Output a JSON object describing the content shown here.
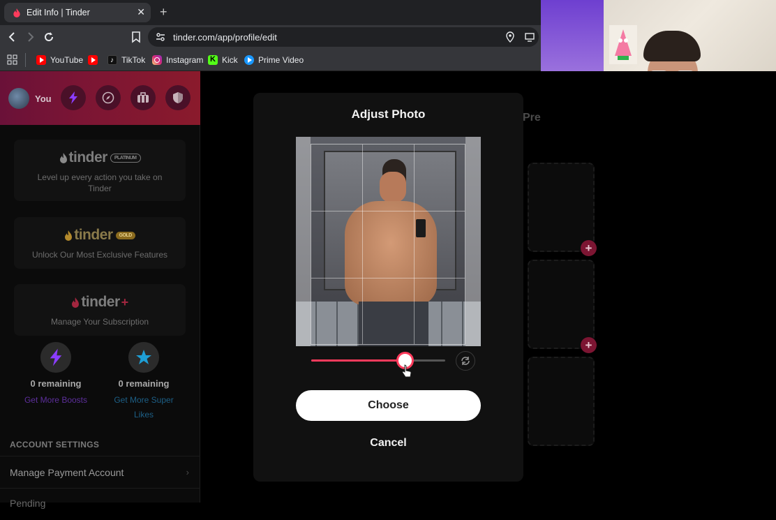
{
  "browser": {
    "tab_title": "Edit Info | Tinder",
    "tab_close": "✕",
    "new_tab": "+",
    "url": "tinder.com/app/profile/edit",
    "bookmarks": [
      {
        "label": "YouTube",
        "color": "#ff0000"
      },
      {
        "label": "TikTok",
        "color": "#111111"
      },
      {
        "label": "Instagram",
        "color": "#d6249f"
      },
      {
        "label": "Kick",
        "color": "#53fc18"
      },
      {
        "label": "Prime Video",
        "color": "#1a98ff"
      }
    ]
  },
  "sidebar": {
    "you_label": "You",
    "promos": [
      {
        "brand": "tinder",
        "tier": "PLATINUM",
        "text": "Level up every action you take on Tinder"
      },
      {
        "brand": "tinder",
        "tier": "GOLD",
        "text": "Unlock Our Most Exclusive Features"
      },
      {
        "brand": "tinder",
        "tier": "+",
        "text": "Manage Your Subscription"
      }
    ],
    "boosts": {
      "remaining": "0 remaining",
      "link": "Get More Boosts"
    },
    "super_likes": {
      "remaining": "0 remaining",
      "link": "Get More Super Likes"
    },
    "account_settings_title": "ACCOUNT SETTINGS",
    "manage_payment": "Manage Payment Account",
    "next_row": "Pending"
  },
  "main": {
    "preview_label": "Pre",
    "add_icon": "+"
  },
  "modal": {
    "title": "Adjust Photo",
    "zoom_level": 0.7,
    "choose": "Choose",
    "cancel": "Cancel"
  },
  "colors": {
    "tinder_accent": "#fe3b5c",
    "boost_purple": "#8b3dff",
    "superlike_blue": "#1e9fd6"
  }
}
